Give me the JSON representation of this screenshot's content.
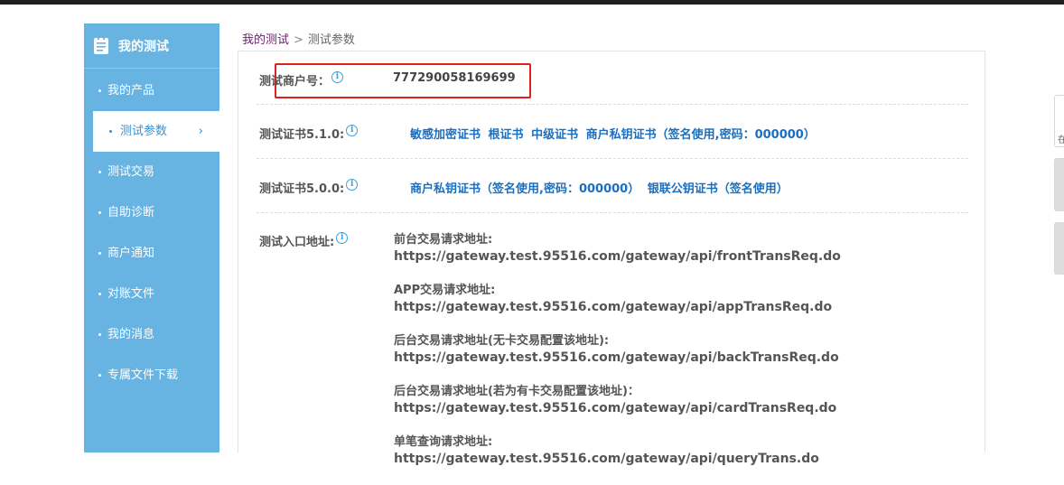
{
  "sidebar": {
    "title": "我的测试",
    "items": [
      {
        "label": "我的产品"
      },
      {
        "label": "测试参数",
        "chevron": "›"
      },
      {
        "label": "测试交易"
      },
      {
        "label": "自助诊断"
      },
      {
        "label": "商户通知"
      },
      {
        "label": "对账文件"
      },
      {
        "label": "我的消息"
      },
      {
        "label": "专属文件下载"
      }
    ]
  },
  "breadcrumb": {
    "link": "我的测试",
    "separator": ">",
    "current": "测试参数"
  },
  "merchant": {
    "label": "测试商户号：",
    "value": "777290058169699"
  },
  "cert510": {
    "label": "测试证书5.1.0:",
    "links": [
      "敏感加密证书",
      "根证书",
      "中级证书",
      "商户私钥证书（签名使用,密码：000000）"
    ]
  },
  "cert500": {
    "label": "测试证书5.0.0:",
    "links": [
      "商户私钥证书（签名使用,密码：000000）",
      "银联公钥证书（签名使用）"
    ]
  },
  "entry": {
    "label": "测试入口地址:",
    "urls": [
      {
        "title": "前台交易请求地址:",
        "url": "https://gateway.test.95516.com/gateway/api/frontTransReq.do"
      },
      {
        "title": "APP交易请求地址:",
        "url": "https://gateway.test.95516.com/gateway/api/appTransReq.do"
      },
      {
        "title": "后台交易请求地址(无卡交易配置该地址):",
        "url": "https://gateway.test.95516.com/gateway/api/backTransReq.do"
      },
      {
        "title": "后台交易请求地址(若为有卡交易配置该地址)：",
        "url": "https://gateway.test.95516.com/gateway/api/cardTransReq.do"
      },
      {
        "title": "单笔查询请求地址:",
        "url": "https://gateway.test.95516.com/gateway/api/queryTrans.do"
      }
    ]
  },
  "info_icon": "i",
  "right_edge": {
    "char": "在"
  },
  "colors": {
    "sidebar_bg": "#67b3e2",
    "link_blue": "#1a6fc0",
    "highlight_red": "#e0201e",
    "breadcrumb_link": "#6b1f6b"
  }
}
